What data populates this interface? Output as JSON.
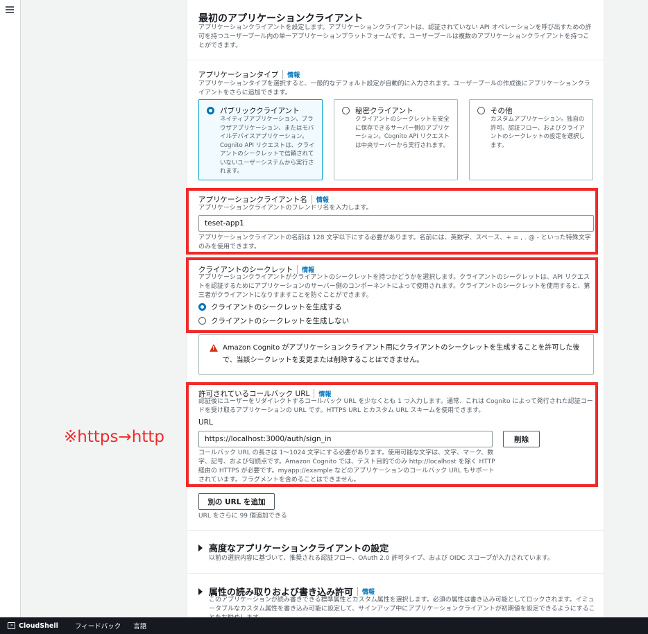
{
  "section": {
    "title": "最初のアプリケーションクライアント",
    "description": "アプリケーションクライアントを設定します。アプリケーションクライアントは、認証されていない API オペレーションを呼び出すための許可を持つユーザープール内の単一アプリケーションプラットフォームです。ユーザープールは複数のアプリケーションクライアントを持つことができます。"
  },
  "app_type": {
    "label": "アプリケーションタイプ",
    "info": "情報",
    "description": "アプリケーションタイプを選択すると、一般的なデフォルト設定が自動的に入力されます。ユーザープールの作成後にアプリケーションクライアントをさらに追加できます。",
    "options": [
      {
        "title": "パブリッククライアント",
        "desc": "ネイティブアプリケーション、ブラウザアプリケーション、またはモバイルデバイスアプリケーション。Cognito API リクエストは、クライアントのシークレットで信頼されていないユーザーシステムから実行されます。"
      },
      {
        "title": "秘密クライアント",
        "desc": "クライアントのシークレットを安全に保存できるサーバー側のアプリケーション。Cognito API リクエストは中央サーバーから実行されます。"
      },
      {
        "title": "その他",
        "desc": "カスタムアプリケーション。独自の許可、認証フロー、およびクライアントのシークレットの設定を選択します。"
      }
    ]
  },
  "client_name": {
    "label": "アプリケーションクライアント名",
    "info": "情報",
    "description": "アプリケーションクライアントのフレンドリ名を入力します。",
    "value": "teset-app1",
    "constraint": "アプリケーションクライアントの名前は 128 文字以下にする必要があります。名前には、英数字、スペース、+ = , . @ - といった特殊文字のみを使用できます。"
  },
  "client_secret": {
    "label": "クライアントのシークレット",
    "info": "情報",
    "description": "アプリケーションクライアントがクライアントのシークレットを持つかどうかを選択します。クライアントのシークレットは、API リクエストを認証するためにアプリケーションのサーバー側のコンポーネントによって使用されます。クライアントのシークレットを使用すると、第三者がクライアントになりすますことを防ぐことができます。",
    "options": [
      "クライアントのシークレットを生成する",
      "クライアントのシークレットを生成しない"
    ]
  },
  "warning": {
    "text": "Amazon Cognito がアプリケーションクライアント用にクライアントのシークレットを生成することを許可した後で、当該シークレットを変更または削除することはできません。"
  },
  "callback": {
    "label": "許可されているコールバック URL",
    "info": "情報",
    "description": "認証後にユーザーをリダイレクトするコールバック URL を少なくとも 1 つ入力します。通常、これは Cognito によって発行された認証コードを受け取るアプリケーションの URL です。HTTPS URL とカスタム URL スキームを使用できます。",
    "url_label": "URL",
    "value": "https://localhost:3000/auth/sign_in",
    "remove_label": "削除",
    "constraint": "コールバック URL の長さは 1～1024 文字にする必要があります。使用可能な文字は、文字、マーク、数字、記号、および句読点です。Amazon Cognito では、テスト目的でのみ http://localhost を除く HTTP 経由の HTTPS が必要です。myapp://example などのアプリケーションのコールバック URL もサポートされています。フラグメントを含めることはできません。",
    "add_label": "別の URL を追加",
    "add_hint": "URL をさらに 99 個追加できる"
  },
  "advanced": {
    "title": "高度なアプリケーションクライアントの設定",
    "description": "以前の選択内容に基づいて、推奨される認証フロー、OAuth 2.0 許可タイプ、および OIDC スコープが入力されています。"
  },
  "attributes": {
    "title": "属性の読み取りおよび書き込み許可",
    "info": "情報",
    "description": "このアプリケーションが読み書きできる標準属性とカスタム属性を選択します。必須の属性は書き込み可能としてロックされます。イミュータブルなカスタム属性を書き込み可能に設定して、サインアップ中にアプリケーションクライアントが初期値を設定できるようにすることをお勧めします。"
  },
  "annotation": "※https→http",
  "footer": {
    "cloudshell": "CloudShell",
    "feedback": "フィードバック",
    "language": "言語"
  },
  "colors": {
    "highlight": "#f02a2a",
    "link": "#0073bb",
    "footer_bg": "#16191f"
  }
}
